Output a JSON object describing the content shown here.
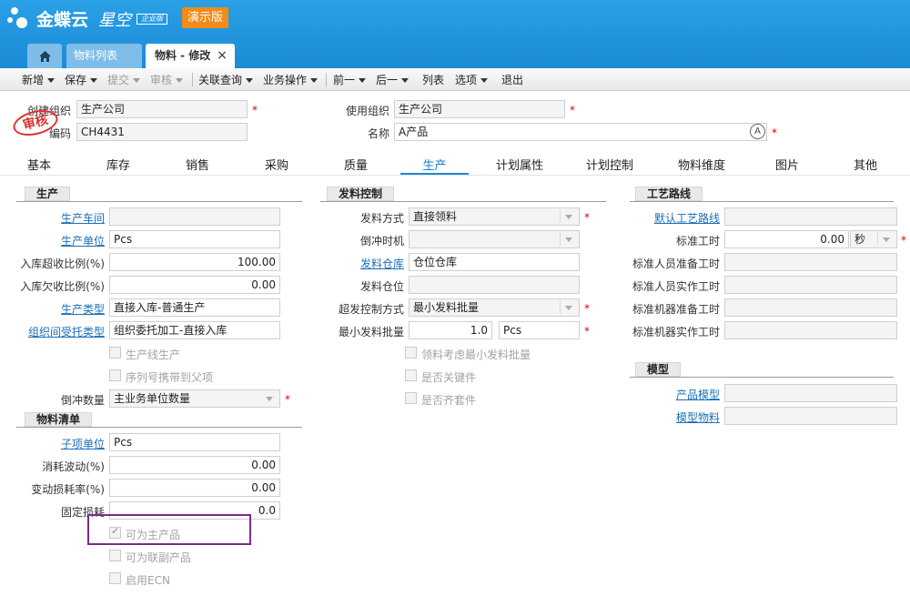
{
  "brand": {
    "name": "金蝶云",
    "product": "星空",
    "edition": "企业版",
    "demo_label": "演示版"
  },
  "tabs": [
    {
      "label": "物料列表"
    },
    {
      "label": "物料 - 修改",
      "close": "×"
    }
  ],
  "toolbar": [
    {
      "label": "新增",
      "menu": true,
      "enabled": true
    },
    {
      "label": "保存",
      "menu": true,
      "enabled": true
    },
    {
      "label": "提交",
      "menu": true,
      "enabled": false
    },
    {
      "label": "审核",
      "menu": true,
      "enabled": false
    },
    {
      "label": "关联查询",
      "menu": true,
      "enabled": true
    },
    {
      "label": "业务操作",
      "menu": true,
      "enabled": true
    },
    {
      "label": "前一",
      "menu": true,
      "enabled": true
    },
    {
      "label": "后一",
      "menu": true,
      "enabled": true
    },
    {
      "label": "列表",
      "menu": false,
      "enabled": true
    },
    {
      "label": "选项",
      "menu": true,
      "enabled": true
    },
    {
      "label": "退出",
      "menu": false,
      "enabled": true
    }
  ],
  "header": {
    "create_org_label": "创建组织",
    "create_org_value": "生产公司",
    "code_label": "编码",
    "code_value": "CH4431",
    "use_org_label": "使用组织",
    "use_org_value": "生产公司",
    "name_label": "名称",
    "name_value": "A产品",
    "stamp": "审核",
    "required_mark": "*"
  },
  "main_tabs": [
    "基本",
    "库存",
    "销售",
    "采购",
    "质量",
    "生产",
    "计划属性",
    "计划控制",
    "物料维度",
    "图片",
    "其他"
  ],
  "active_tab": "生产",
  "production": {
    "title": "生产",
    "workshop_label": "生产车间",
    "workshop_value": "",
    "unit_label": "生产单位",
    "unit_value": "Pcs",
    "over_ratio_label": "入库超收比例(%)",
    "over_ratio_value": "100.00",
    "under_ratio_label": "入库欠收比例(%)",
    "under_ratio_value": "0.00",
    "type_label": "生产类型",
    "type_value": "直接入库-普通生产",
    "consign_label": "组织间受托类型",
    "consign_value": "组织委托加工-直接入库",
    "line_prod_label": "生产线生产",
    "serial_label": "序列号携带到父项",
    "backflush_qty_label": "倒冲数量",
    "backflush_qty_value": "主业务单位数量"
  },
  "bom": {
    "title": "物料清单",
    "sub_unit_label": "子项单位",
    "sub_unit_value": "Pcs",
    "loss_wave_label": "消耗波动(%)",
    "loss_wave_value": "0.00",
    "var_loss_label": "变动损耗率(%)",
    "var_loss_value": "0.00",
    "fixed_loss_label": "固定损耗",
    "fixed_loss_value": "0.0",
    "main_product_label": "可为主产品",
    "main_product_checked": true,
    "co_product_label": "可为联副产品",
    "co_product_checked": false,
    "ecn_label": "启用ECN",
    "ecn_checked": false
  },
  "issue": {
    "title": "发料控制",
    "method_label": "发料方式",
    "method_value": "直接领料",
    "backflush_time_label": "倒冲时机",
    "backflush_time_value": "",
    "warehouse_label": "发料仓库",
    "warehouse_value": "仓位仓库",
    "location_label": "发料仓位",
    "location_value": "",
    "over_control_label": "超发控制方式",
    "over_control_value": "最小发料批量",
    "min_batch_label": "最小发料批量",
    "min_batch_value": "1.0",
    "min_batch_unit": "Pcs",
    "consider_min_label": "领料考虑最小发料批量",
    "key_part_label": "是否关键件",
    "kit_label": "是否齐套件"
  },
  "routing": {
    "title": "工艺路线",
    "default_route_label": "默认工艺路线",
    "default_route_value": "",
    "std_hours_label": "标准工时",
    "std_hours_value": "0.00",
    "std_hours_unit": "秒",
    "std_prep_label": "标准人员准备工时",
    "std_prep_value": "",
    "std_actual_label": "标准人员实作工时",
    "std_actual_value": "",
    "machine_prep_label": "标准机器准备工时",
    "machine_prep_value": "",
    "machine_actual_label": "标准机器实作工时",
    "machine_actual_value": ""
  },
  "model": {
    "title": "模型",
    "product_model_label": "产品模型",
    "product_model_value": "",
    "model_material_label": "模型物料",
    "model_material_value": ""
  }
}
